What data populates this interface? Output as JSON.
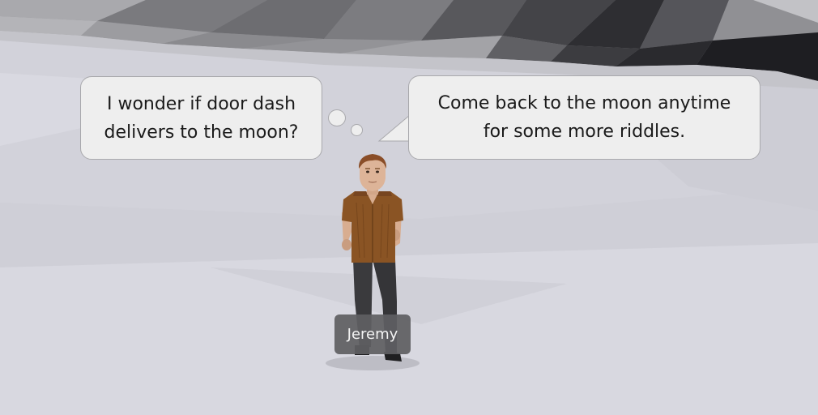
{
  "thought_bubble": {
    "lines": [
      "I wonder if door dash",
      "delivers to the moon?"
    ]
  },
  "speech_bubble": {
    "lines": [
      "Come back to the moon anytime",
      "for some more riddles."
    ]
  },
  "player": {
    "name": "Jeremy"
  }
}
